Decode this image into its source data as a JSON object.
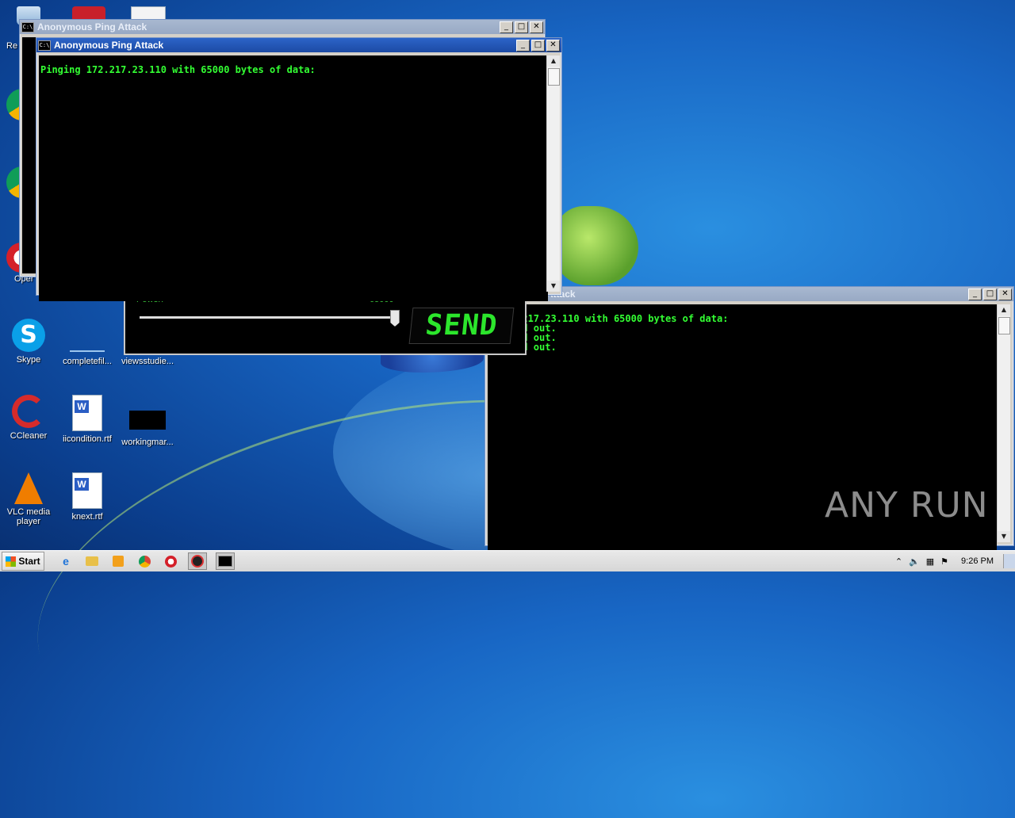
{
  "desktop": {
    "icons": [
      {
        "label": "Re",
        "icon": "recycle-bin-icon"
      },
      {
        "label": "Skype",
        "icon": "skype-icon"
      },
      {
        "label": "completefil...",
        "icon": "file-icon"
      },
      {
        "label": "viewsstudie...",
        "icon": "file-icon"
      },
      {
        "label": "CCleaner",
        "icon": "ccleaner-icon"
      },
      {
        "label": "iicondition.rtf",
        "icon": "word-document-icon"
      },
      {
        "label": "workingmar...",
        "icon": "image-file-icon"
      },
      {
        "label": "VLC media player",
        "icon": "vlc-icon"
      },
      {
        "label": "knext.rtf",
        "icon": "word-document-icon"
      },
      {
        "label": "Oper",
        "icon": "opera-icon"
      }
    ]
  },
  "windows": {
    "back": {
      "title": "Anonymous Ping Attack"
    },
    "front": {
      "title": "Anonymous Ping Attack",
      "output": "Pinging 172.217.23.110 with 65000 bytes of data:"
    },
    "right": {
      "title": "ing Attack",
      "output": "g 172.217.23.110 with 65000 bytes of data:\nt timed out.\nt timed out.\nt timed out."
    }
  },
  "ping_tool": {
    "power_label": "Power:",
    "power_value": "65000",
    "send_label": "SEND",
    "power_level": 1.0
  },
  "taskbar": {
    "start_label": "Start",
    "items": [
      "ie-icon",
      "explorer-icon",
      "media-player-icon",
      "chrome-icon",
      "opera-icon",
      "ping-tool-icon",
      "cmd-icon"
    ],
    "clock": "9:26 PM"
  },
  "watermark": "ANY RUN"
}
